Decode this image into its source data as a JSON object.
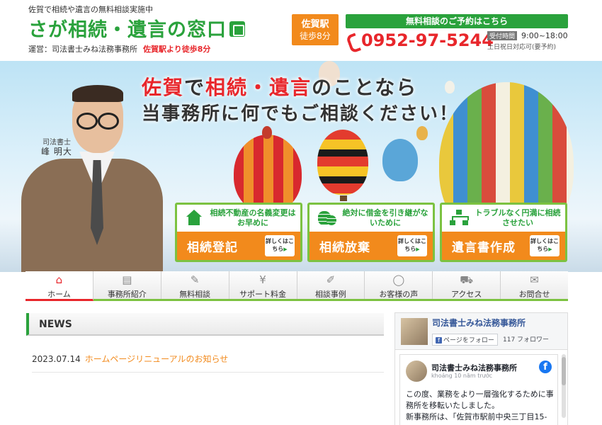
{
  "header": {
    "tagline": "佐賀で相続や遺言の無料相談実施中",
    "logo": "さが相続・遺言の窓口",
    "operator": "運営：司法書士みね法務事務所",
    "station_text": "佐賀駅",
    "walk_text": "より徒歩8分",
    "station_badge": {
      "line1": "佐賀駅",
      "line2": "徒歩8分"
    },
    "reserve_label": "無料相談のご予約はこちら",
    "phone": "0952-97-5244",
    "hours_tag": "受付時間",
    "hours_time": "9:00~18:00",
    "hours_note": "土日祝日対応可(要予約)"
  },
  "hero": {
    "headline1_red1": "佐賀",
    "headline1_mid": "で",
    "headline1_red2": "相続・遺言",
    "headline1_end": "のことなら",
    "headline2": "当事務所に何でもご相談ください！",
    "person_title": "司法書士",
    "person_name": "峰 明大",
    "cards": [
      {
        "desc": "相続不動産の名義変更はお早めに",
        "label": "相続登記",
        "detail": "詳しくはこちら",
        "icon": "house-icon"
      },
      {
        "desc": "絶対に借金を引き継がないために",
        "label": "相続放棄",
        "detail": "詳しくはこちら",
        "icon": "coins-icon"
      },
      {
        "desc": "トラブルなく円満に相続させたい",
        "label": "遺言書作成",
        "detail": "詳しくはこちら",
        "icon": "tree-icon"
      }
    ]
  },
  "nav": [
    {
      "label": "ホーム",
      "icon": "home-icon",
      "glyph": "⌂"
    },
    {
      "label": "事務所紹介",
      "icon": "office-icon",
      "glyph": "▤"
    },
    {
      "label": "無料相談",
      "icon": "document-icon",
      "glyph": "✎"
    },
    {
      "label": "サポート料金",
      "icon": "price-icon",
      "glyph": "¥"
    },
    {
      "label": "相談事例",
      "icon": "pen-icon",
      "glyph": "✐"
    },
    {
      "label": "お客様の声",
      "icon": "speech-icon",
      "glyph": "◯"
    },
    {
      "label": "アクセス",
      "icon": "car-icon",
      "glyph": "⛟"
    },
    {
      "label": "お問合せ",
      "icon": "mail-icon",
      "glyph": "✉"
    }
  ],
  "news": {
    "heading": "NEWS",
    "items": [
      {
        "date": "2023.07.14",
        "title": "ホームページリニューアルのお知らせ"
      }
    ]
  },
  "facebook": {
    "page_name": "司法書士みね法務事務所",
    "follow_label": "ページをフォロー",
    "followers": "117 フォロワー",
    "post_name": "司法書士みね法務事務所",
    "post_time": "khoảng 10 năm trước",
    "post_text1": "この度、業務をより一層強化するために事務所を移転いたしました。",
    "post_text2": "新事務所は、「佐賀市駅前中央三丁目15-"
  },
  "colors": {
    "brand_green": "#2aa23c",
    "accent_orange": "#f28a1c",
    "accent_red": "#e8262b"
  }
}
